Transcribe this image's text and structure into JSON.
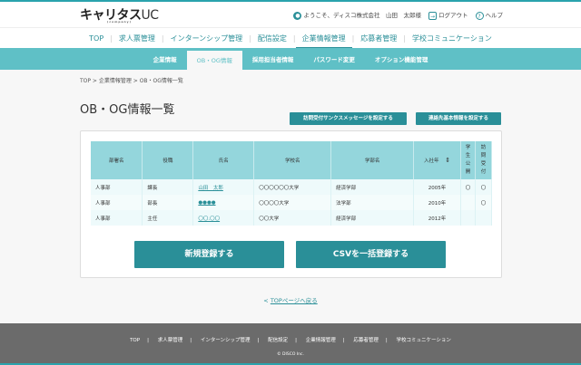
{
  "header": {
    "logo": "キャリタス",
    "logo_uc": "UC",
    "logo_sub": "(company)",
    "welcome": "ようこそ、ディスコ株式会社　山田　太郎様",
    "logout": "ログアウト",
    "help": "ヘルプ"
  },
  "main_nav": [
    "TOP",
    "求人票管理",
    "インターンシップ管理",
    "配信設定",
    "企業情報管理",
    "応募者管理",
    "学校コミュニケーション"
  ],
  "sub_nav": [
    "企業情報",
    "OB・OG情報",
    "採用担当者情報",
    "パスワード変更",
    "オプション機能管理"
  ],
  "breadcrumb": "TOP > 企業情報管理 > OB・OG情報一覧",
  "page_title": "OB・OG情報一覧",
  "buttons": {
    "thanks_message": "訪問受付サンクスメッセージを設定する",
    "contact_info": "連絡先基本情報を設定する",
    "new_register": "新規登録する",
    "csv_register": "CSVを一括登録する"
  },
  "table": {
    "headers": [
      "部署名",
      "役職",
      "氏名",
      "学校名",
      "学部名",
      "入社年",
      "学生公開",
      "訪問受付"
    ],
    "rows": [
      [
        "人事部",
        "課長",
        "山田　太郎",
        "〇〇〇〇〇〇大学",
        "経済学部",
        "2005年",
        "〇",
        "〇"
      ],
      [
        "人事部",
        "部長",
        "●●●●",
        "〇〇〇〇大学",
        "法学部",
        "2010年",
        "",
        "〇"
      ],
      [
        "人事部",
        "主任",
        "〇〇.〇〇",
        "〇〇大学",
        "経済学部",
        "2012年",
        "",
        ""
      ]
    ]
  },
  "back_link": "TOPページへ戻る",
  "footer": {
    "nav": [
      "TOP",
      "求人票管理",
      "インターンシップ管理",
      "配信設定",
      "企業情報管理",
      "応募者管理",
      "学校コミュニケーション"
    ],
    "copyright": "© DISCO Inc."
  }
}
